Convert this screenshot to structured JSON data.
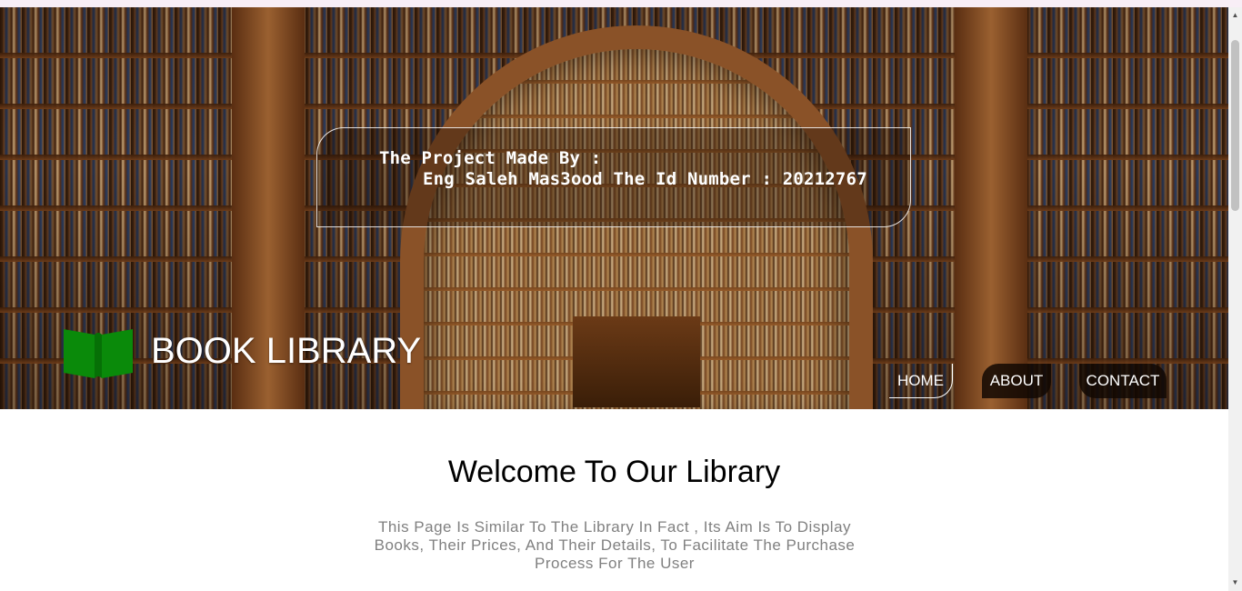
{
  "header": {
    "project_card": {
      "line1": "The Project Made By :",
      "line2": "Eng Saleh Mas3ood The Id Number : 20212767"
    },
    "logo": {
      "icon": "open-book-icon",
      "text": "BOOK LIBRARY",
      "icon_color": "#0a8a0a"
    },
    "nav": {
      "items": [
        {
          "label": "HOME",
          "active": true
        },
        {
          "label": "ABOUT",
          "active": false
        },
        {
          "label": "CONTACT",
          "active": false
        }
      ]
    }
  },
  "main": {
    "title": "Welcome To Our Library",
    "description": "This Page Is Similar To The Library In Fact , Its Aim Is To Display Books, Their Prices, And Their Details, To Facilitate The Purchase Process For The User"
  },
  "scrollbar": {
    "up_icon": "arrow-up-icon",
    "down_icon": "arrow-down-icon"
  }
}
